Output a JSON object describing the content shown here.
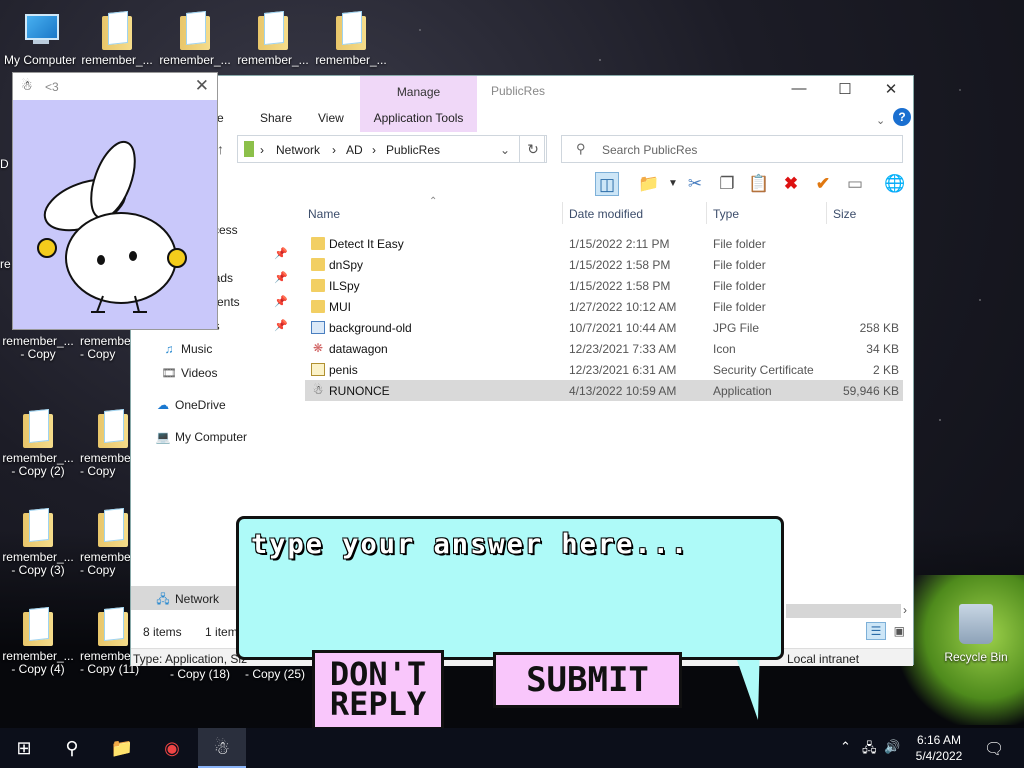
{
  "desktop": {
    "icons_top": [
      {
        "label": "My Computer",
        "kind": "pc"
      },
      {
        "label": "remember_...",
        "kind": "folder"
      },
      {
        "label": "remember_...",
        "kind": "folder"
      },
      {
        "label": "remember_...",
        "kind": "folder"
      },
      {
        "label": "remember_...",
        "kind": "folder"
      }
    ],
    "icons_grid": [
      {
        "line1": "remember_...",
        "line2": "- Copy"
      },
      {
        "line1": "remembe",
        "line2": "- Copy"
      },
      {
        "line1": "remember_...",
        "line2": "- Copy (2)"
      },
      {
        "line1": "remembe",
        "line2": "- Copy"
      },
      {
        "line1": "remember_...",
        "line2": "- Copy (3)"
      },
      {
        "line1": "remembe",
        "line2": "- Copy"
      },
      {
        "line1": "remember_...",
        "line2": "- Copy (4)"
      },
      {
        "line1": "remembe",
        "line2": "- Copy (11)"
      }
    ],
    "partial_labels": [
      "- Copy (18)",
      "- Copy (25)"
    ],
    "side_fragments": [
      "D",
      "re"
    ],
    "recycle_bin": "Recycle Bin"
  },
  "explorer": {
    "title": "PublicRes",
    "manage_tab": "Manage",
    "app_tools": "Application Tools",
    "ribbon_tabs": [
      "me",
      "Share",
      "View"
    ],
    "breadcrumb": [
      "Network",
      "AD",
      "PublicRes"
    ],
    "search_placeholder": "Search PublicRes",
    "nav": {
      "quick_access_fragment": "ccess",
      "pinned_fragments": [
        "p",
        "oads",
        "ments",
        "es"
      ],
      "music": "Music",
      "videos": "Videos",
      "onedrive": "OneDrive",
      "my_computer": "My Computer",
      "network": "Network"
    },
    "columns": {
      "name": "Name",
      "date": "Date modified",
      "type": "Type",
      "size": "Size"
    },
    "rows": [
      {
        "name": "Detect It Easy",
        "date": "1/15/2022 2:11 PM",
        "type": "File folder",
        "size": "",
        "icon": "folder"
      },
      {
        "name": "dnSpy",
        "date": "1/15/2022 1:58 PM",
        "type": "File folder",
        "size": "",
        "icon": "folder"
      },
      {
        "name": "ILSpy",
        "date": "1/15/2022 1:58 PM",
        "type": "File folder",
        "size": "",
        "icon": "folder"
      },
      {
        "name": "MUI",
        "date": "1/27/2022 10:12 AM",
        "type": "File folder",
        "size": "",
        "icon": "folder"
      },
      {
        "name": "background-old",
        "date": "10/7/2021 10:44 AM",
        "type": "JPG File",
        "size": "258 KB",
        "icon": "image"
      },
      {
        "name": "datawagon",
        "date": "12/23/2021 7:33 AM",
        "type": "Icon",
        "size": "34 KB",
        "icon": "icon"
      },
      {
        "name": "penis",
        "date": "12/23/2021 6:31 AM",
        "type": "Security Certificate",
        "size": "2 KB",
        "icon": "cert"
      },
      {
        "name": "RUNONCE",
        "date": "4/13/2022 10:59 AM",
        "type": "Application",
        "size": "59,946 KB",
        "icon": "app"
      }
    ],
    "selected_row": "RUNONCE",
    "status_items": "8 items",
    "status_fragment": "1 item",
    "info_left": "Type: Application, Siz",
    "info_right": "Local intranet"
  },
  "bunny_window": {
    "title": "<3"
  },
  "bubble": {
    "prompt": "type your answer here...",
    "dont_reply": "DON'T REPLY",
    "submit": "SUBMIT"
  },
  "taskbar": {
    "time": "6:16 AM",
    "date": "5/4/2022"
  }
}
